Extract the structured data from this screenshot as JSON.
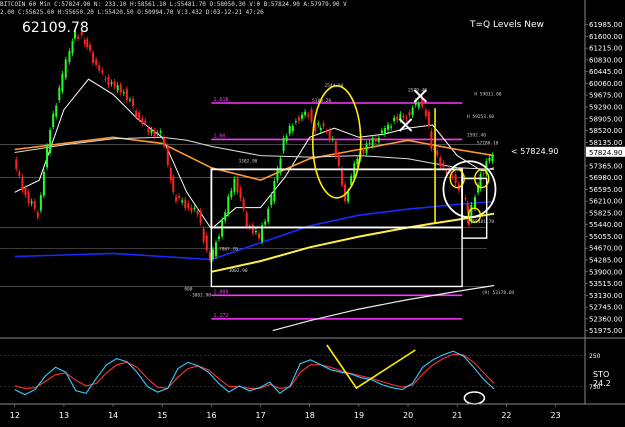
{
  "header": {
    "line1": "BITCOIN 60 Min  C:57824.90  N:  233.10  H:58561.10  L:55481.70  O:58050.30  V:0  B:57824.90  A:57979.90  V",
    "line2": "2.00  C:55625.60  H:55650.20  L:55420.50  O:50994.70  V:3.432  D:03-12-21  47:26"
  },
  "big_price": "62109.78",
  "title_label": "T=Q Levels New",
  "current_price_label": "< 57824.90",
  "current_price_box": "57824.90",
  "sto_label": "STO  24.2",
  "colors": {
    "background": "#000000",
    "up_candle": "#22ff22",
    "down_candle": "#ff2222",
    "white_ma": "#ffffff",
    "orange_ma": "#ff9933",
    "blue_ma": "#1a2aff",
    "yellow_ma": "#ffee44",
    "magenta_level": "#ff33ff",
    "annotation_yellow": "#ffee00",
    "annotation_white": "#ffffff",
    "sto_cyan": "#33ccff",
    "sto_red": "#ff3333"
  },
  "chart_data": {
    "type": "line",
    "title": "T=Q Levels New",
    "symbol": "BITCOIN 60 Min",
    "x_ticks": [
      "12",
      "13",
      "14",
      "15",
      "16",
      "17",
      "18",
      "19",
      "20",
      "21",
      "22",
      "23"
    ],
    "y_ticks": [
      "61985.00",
      "61600.00",
      "61215.00",
      "60830.00",
      "60445.00",
      "60060.00",
      "59675.00",
      "59290.00",
      "58905.00",
      "58520.00",
      "58135.00",
      "57750.00",
      "57365.00",
      "56980.00",
      "56595.00",
      "56210.00",
      "55825.00",
      "55440.00",
      "55055.00",
      "54670.00",
      "54285.00",
      "53900.00",
      "53515.00",
      "53130.00",
      "52745.00",
      "52360.00",
      "51975.00"
    ],
    "ylim": [
      51800,
      62200
    ],
    "xlim": [
      11.7,
      23.6
    ],
    "price": {
      "x": [
        12.0,
        12.25,
        12.5,
        12.75,
        13.0,
        13.15,
        13.25,
        13.4,
        13.5,
        13.75,
        14.0,
        14.25,
        14.5,
        14.75,
        15.0,
        15.15,
        15.25,
        15.5,
        15.75,
        16.0,
        16.25,
        16.5,
        16.75,
        17.0,
        17.25,
        17.5,
        17.75,
        18.0,
        18.15,
        18.25,
        18.5,
        18.75,
        19.0,
        19.25,
        19.5,
        19.75,
        20.0,
        20.25,
        20.4,
        20.5,
        20.75,
        21.0,
        21.2,
        21.25,
        21.4,
        21.5,
        21.75
      ],
      "y": [
        57500,
        56400,
        55800,
        58600,
        60300,
        61150,
        61700,
        61550,
        61300,
        60400,
        60000,
        59800,
        59100,
        58500,
        58400,
        57400,
        56400,
        56100,
        55800,
        54200,
        55500,
        57000,
        55500,
        55000,
        56300,
        58200,
        58900,
        59100,
        58600,
        58700,
        58200,
        56300,
        57700,
        58100,
        58400,
        58900,
        59000,
        59500,
        59100,
        58000,
        57300,
        56900,
        56200,
        55550,
        56400,
        57000,
        57824.9
      ]
    },
    "series": [
      {
        "color": "white",
        "x": [
          12.0,
          12.5,
          13.0,
          13.5,
          14.0,
          14.5,
          15.0,
          15.5,
          16.0,
          16.5,
          17.0,
          17.5,
          18.0,
          18.5,
          19.0,
          19.5,
          20.0,
          20.5,
          21.0,
          21.5,
          21.75
        ],
        "y": [
          56500,
          56900,
          59200,
          60200,
          59700,
          58900,
          58300,
          56500,
          55300,
          56000,
          56000,
          57000,
          58300,
          58600,
          58300,
          58400,
          58600,
          58700,
          57700,
          57200,
          57300
        ]
      },
      {
        "color": "orange",
        "x": [
          12.0,
          13.0,
          14.0,
          15.0,
          16.0,
          17.0,
          18.0,
          19.0,
          20.0,
          21.0,
          21.75
        ],
        "y": [
          57900,
          58100,
          58300,
          58100,
          57300,
          56900,
          57600,
          57900,
          58200,
          57900,
          57700
        ]
      },
      {
        "color": "white2",
        "x": [
          12.0,
          13.0,
          14.0,
          15.0,
          15.5,
          16.0,
          17.0,
          18.0,
          19.0,
          20.0,
          21.0,
          21.75
        ],
        "y": [
          57800,
          58050,
          58250,
          58300,
          58200,
          58000,
          57700,
          57650,
          57700,
          57600,
          57300,
          57250
        ]
      },
      {
        "color": "blue",
        "x": [
          12.0,
          13.0,
          14.0,
          15.0,
          16.0,
          17.0,
          18.0,
          19.0,
          20.0,
          21.0,
          21.75
        ],
        "y": [
          54400,
          54450,
          54500,
          54400,
          54300,
          54850,
          55400,
          55750,
          55950,
          56100,
          56200
        ]
      },
      {
        "color": "yellow",
        "x": [
          16.0,
          17.0,
          18.0,
          19.0,
          20.0,
          20.5,
          21.0,
          21.75
        ],
        "y": [
          53900,
          54250,
          54700,
          55050,
          55350,
          55480,
          55600,
          55800
        ]
      },
      {
        "color": "white_lower",
        "x": [
          17.25,
          18.0,
          19.0,
          20.0,
          21.0,
          21.75
        ],
        "y": [
          51975,
          52300,
          52680,
          52990,
          53260,
          53450
        ]
      }
    ],
    "levels": [
      {
        "y": 59420,
        "label": "1.618",
        "color": "magenta",
        "x0": 16.0,
        "x1": 21.1
      },
      {
        "y": 58230,
        "label": "1.00",
        "color": "magenta",
        "x0": 16.0,
        "x1": 21.1
      },
      {
        "y": 53130,
        "label": "1.000",
        "color": "magenta",
        "x0": 16.0,
        "x1": 21.1
      },
      {
        "y": 52360,
        "label": "1.272",
        "color": "magenta",
        "x0": 16.0,
        "x1": 21.1
      },
      {
        "y": 58070,
        "label": "",
        "color": "gray",
        "x0": 11.7,
        "x1": 21.6
      },
      {
        "y": 56980,
        "label": "",
        "color": "gray",
        "x0": 11.7,
        "x1": 21.6
      },
      {
        "y": 55350,
        "label": "",
        "color": "gray",
        "x0": 11.7,
        "x1": 21.6
      },
      {
        "y": 54670,
        "label": "",
        "color": "gray",
        "x0": 11.7,
        "x1": 21.6
      },
      {
        "y": 53420,
        "label": "",
        "color": "gray",
        "x0": 11.7,
        "x1": 21.6
      }
    ],
    "annotations": [
      {
        "text": "2544.50",
        "x": 18.3,
        "y": 59950
      },
      {
        "text": "5103.20",
        "x": 18.05,
        "y": 59460
      },
      {
        "text": "2579.40",
        "x": 20.0,
        "y": 59800
      },
      {
        "text": "H 59811.00",
        "x": 21.35,
        "y": 59660
      },
      {
        "text": "H 59253.60",
        "x": 21.2,
        "y": 58930
      },
      {
        "text": "2592.40",
        "x": 21.2,
        "y": 58330
      },
      {
        "text": "57788.10",
        "x": 21.4,
        "y": 58060
      },
      {
        "text": "3302.90",
        "x": 16.55,
        "y": 57480
      },
      {
        "text": "-7987.70",
        "x": 16.1,
        "y": 54600
      },
      {
        "text": "3002.90",
        "x": 16.35,
        "y": 53900
      },
      {
        "text": "L 55481.70",
        "x": 21.2,
        "y": 55500
      },
      {
        "text": "(R) 53178.04",
        "x": 21.5,
        "y": 53180
      },
      {
        "text": "000",
        "x": 15.45,
        "y": 53280
      },
      {
        "text": "-3002.90",
        "x": 15.55,
        "y": 53090
      }
    ],
    "stochastic": {
      "ticks": [
        "250",
        "750"
      ],
      "k": [
        200,
        120,
        200,
        420,
        560,
        480,
        180,
        140,
        380,
        600,
        700,
        650,
        480,
        250,
        160,
        220,
        540,
        640,
        580,
        480,
        300,
        160,
        260,
        180,
        230,
        320,
        140,
        260,
        620,
        680,
        600,
        520,
        480,
        450,
        390,
        360,
        280,
        230,
        200,
        300,
        560,
        680,
        760,
        820,
        740,
        560,
        360,
        210
      ],
      "d": [
        260,
        220,
        230,
        330,
        440,
        470,
        350,
        260,
        300,
        470,
        600,
        640,
        560,
        380,
        240,
        220,
        400,
        540,
        580,
        520,
        380,
        250,
        250,
        220,
        220,
        280,
        220,
        240,
        480,
        600,
        600,
        560,
        500,
        460,
        420,
        380,
        330,
        280,
        240,
        270,
        450,
        600,
        700,
        770,
        760,
        640,
        470,
        300
      ]
    }
  }
}
